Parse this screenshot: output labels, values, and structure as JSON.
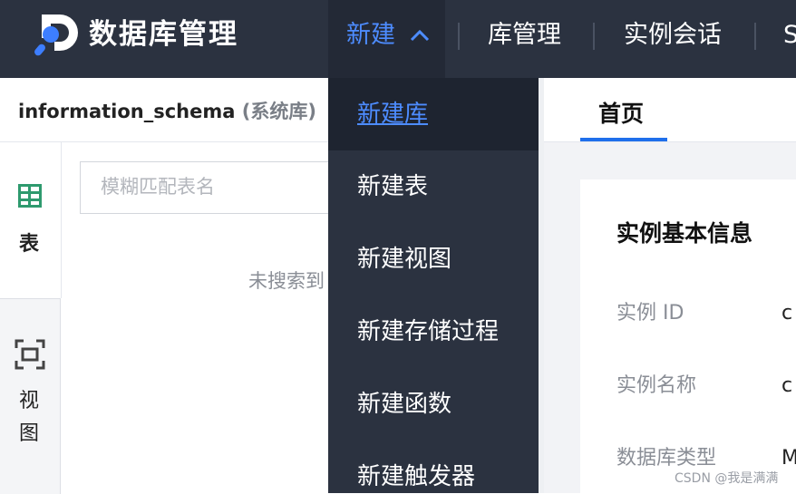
{
  "app": {
    "title": "数据库管理"
  },
  "nav": {
    "new_label": "新建",
    "items": [
      "库管理",
      "实例会话",
      "S"
    ]
  },
  "dropdown": {
    "items": [
      "新建库",
      "新建表",
      "新建视图",
      "新建存储过程",
      "新建函数",
      "新建触发器"
    ],
    "active_index": 0
  },
  "database": {
    "name": "information_schema",
    "tag": "(系统库)"
  },
  "side_tabs": {
    "table_label": "表",
    "view_label_1": "视",
    "view_label_2": "图"
  },
  "search": {
    "placeholder": "模糊匹配表名",
    "empty_text": "未搜索到"
  },
  "main": {
    "tab_home": "首页"
  },
  "card": {
    "title": "实例基本信息",
    "rows": [
      {
        "label": "实例 ID",
        "value": "c"
      },
      {
        "label": "实例名称",
        "value": "c"
      },
      {
        "label": "数据库类型",
        "value": "M"
      }
    ]
  },
  "watermark": "CSDN @我是满满",
  "colors": {
    "topbar": "#2b3240",
    "accent": "#4d8cff",
    "tab_underline": "#1f6feb",
    "table_icon": "#2e9a6e"
  }
}
